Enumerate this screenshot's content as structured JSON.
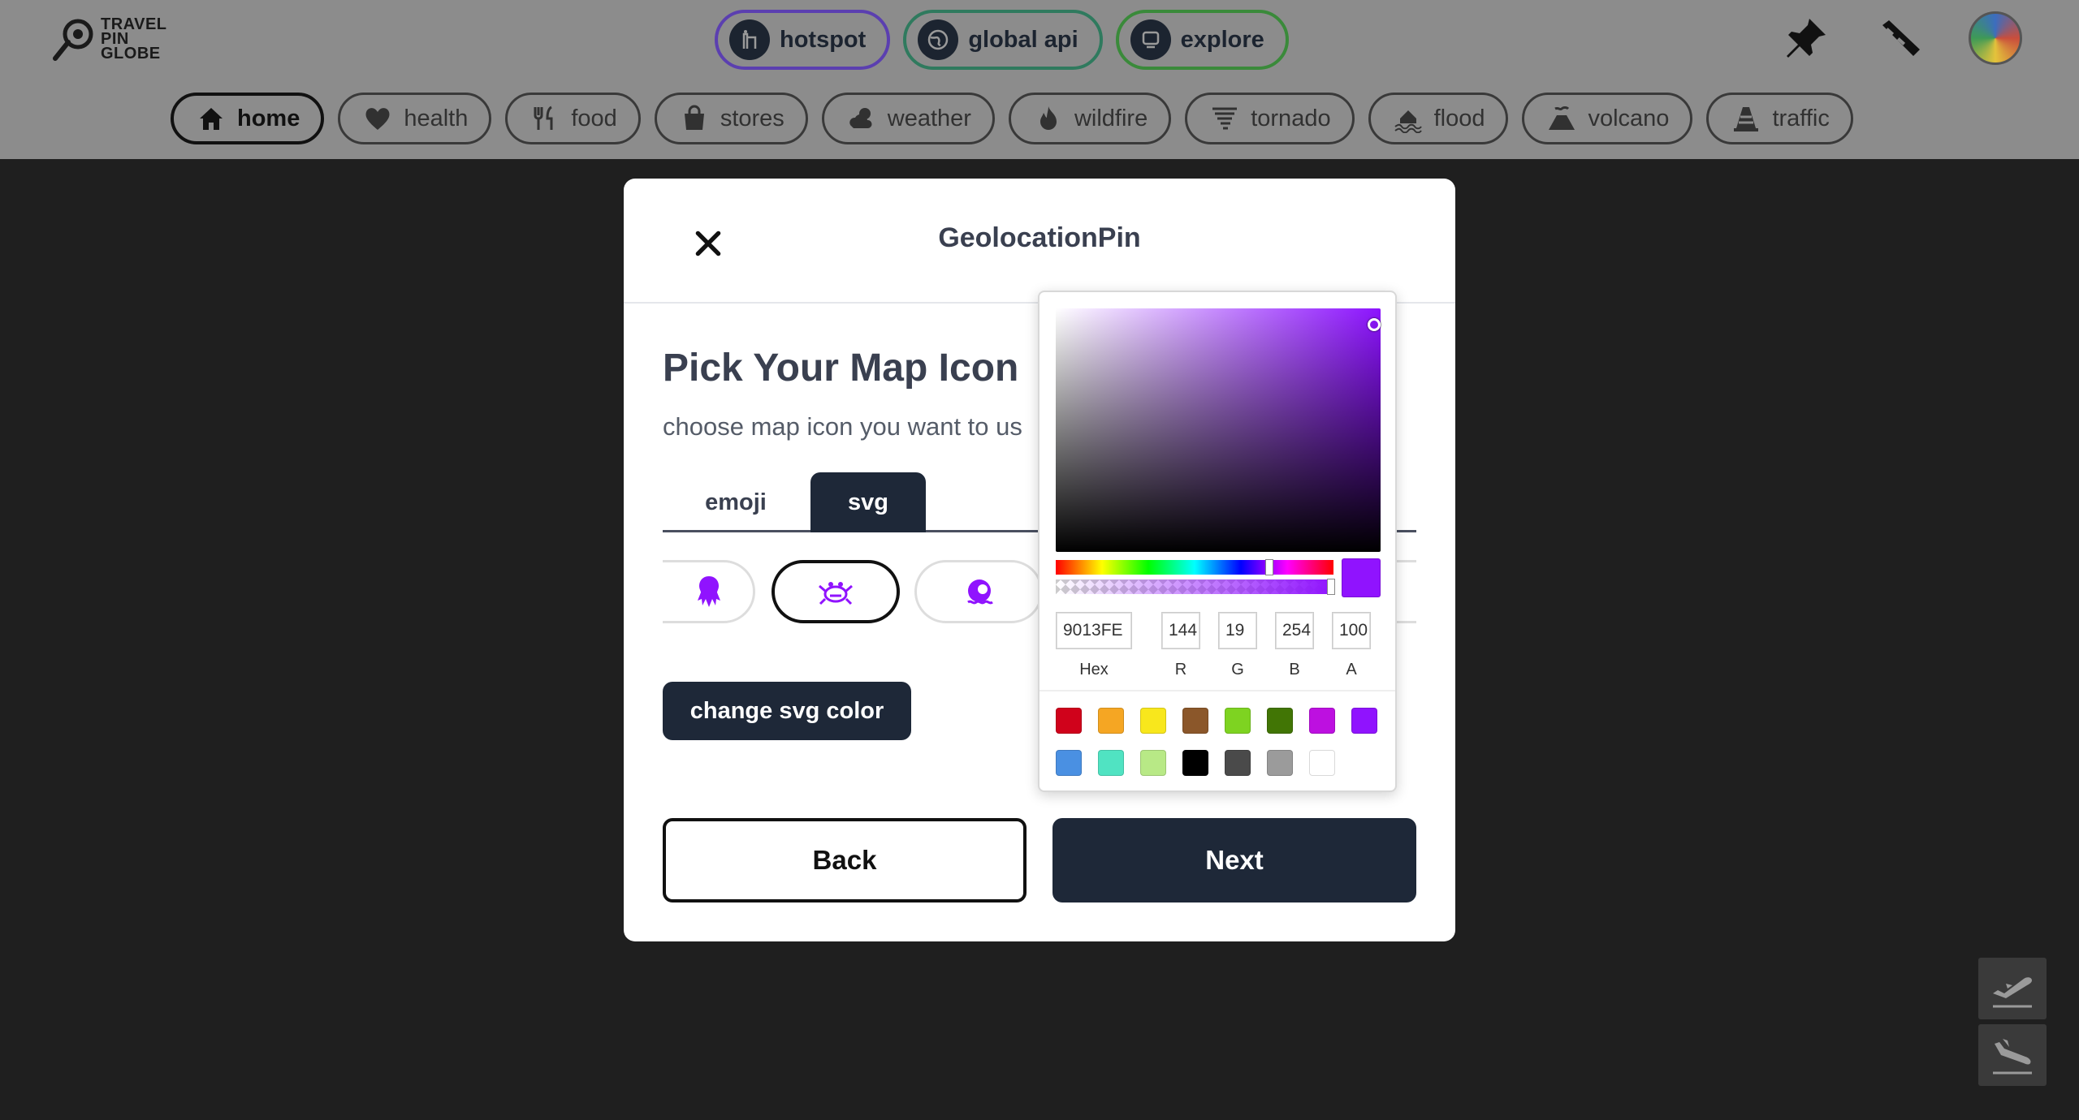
{
  "header": {
    "logo_lines": [
      "TRAVEL",
      "PIN",
      "GLOBE"
    ],
    "top_pills": [
      {
        "label": "hotspot",
        "icon": "hotspot-icon"
      },
      {
        "label": "global api",
        "icon": "globe-icon"
      },
      {
        "label": "explore",
        "icon": "explore-icon"
      }
    ],
    "categories": [
      {
        "label": "home",
        "icon": "house-icon",
        "active": true
      },
      {
        "label": "health",
        "icon": "heart-icon"
      },
      {
        "label": "food",
        "icon": "utensils-icon"
      },
      {
        "label": "stores",
        "icon": "shopping-bag-icon"
      },
      {
        "label": "weather",
        "icon": "cloud-sun-icon"
      },
      {
        "label": "wildfire",
        "icon": "fire-icon"
      },
      {
        "label": "tornado",
        "icon": "tornado-icon"
      },
      {
        "label": "flood",
        "icon": "flood-icon"
      },
      {
        "label": "volcano",
        "icon": "volcano-icon"
      },
      {
        "label": "traffic",
        "icon": "traffic-cone-icon"
      }
    ]
  },
  "modal": {
    "title": "GeolocationPin",
    "heading": "Pick Your Map Icon",
    "subtitle": "choose map icon you want to us",
    "tabs": {
      "emoji": "emoji",
      "svg": "svg"
    },
    "change_color_label": "change svg color",
    "back_label": "Back",
    "next_label": "Next"
  },
  "picker": {
    "color": "#9013fe",
    "hex": "9013FE",
    "r": "144",
    "g": "19",
    "b": "254",
    "a": "100",
    "labels": {
      "hex": "Hex",
      "r": "R",
      "g": "G",
      "b": "B",
      "a": "A"
    },
    "presets": [
      "#d0021b",
      "#f5a623",
      "#f8e71c",
      "#8b572a",
      "#7ed321",
      "#417505",
      "#bd10e0",
      "#9013fe",
      "#4a90e2",
      "#50e3c2",
      "#b8e986",
      "#000000",
      "#4a4a4a",
      "#9b9b9b",
      "#ffffff"
    ]
  }
}
